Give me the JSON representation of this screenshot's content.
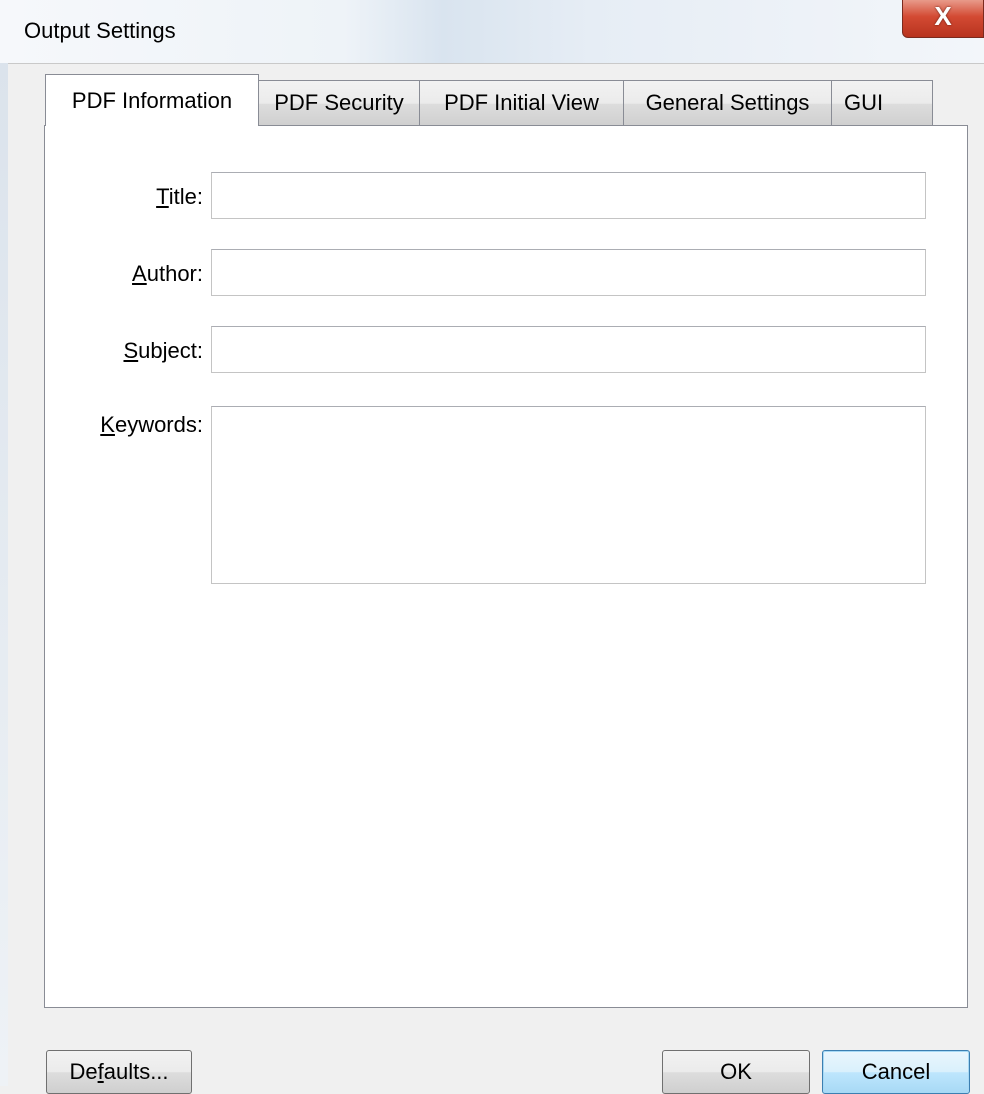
{
  "window": {
    "title": "Output Settings",
    "close_glyph": "X"
  },
  "tabs": [
    {
      "label": "PDF Information",
      "active": true
    },
    {
      "label": "PDF Security",
      "active": false
    },
    {
      "label": "PDF Initial View",
      "active": false
    },
    {
      "label": "General Settings",
      "active": false
    },
    {
      "label": "GUI",
      "active": false
    }
  ],
  "form": {
    "title": {
      "mnemonic": "T",
      "rest": "itle:",
      "value": ""
    },
    "author": {
      "mnemonic": "A",
      "rest": "uthor:",
      "value": ""
    },
    "subject": {
      "mnemonic": "S",
      "rest": "ubject:",
      "value": ""
    },
    "keywords": {
      "mnemonic": "K",
      "rest": "eywords:",
      "value": ""
    }
  },
  "buttons": {
    "defaults": {
      "pre": "De",
      "mnemonic": "f",
      "post": "aults..."
    },
    "ok": "OK",
    "cancel": "Cancel"
  }
}
